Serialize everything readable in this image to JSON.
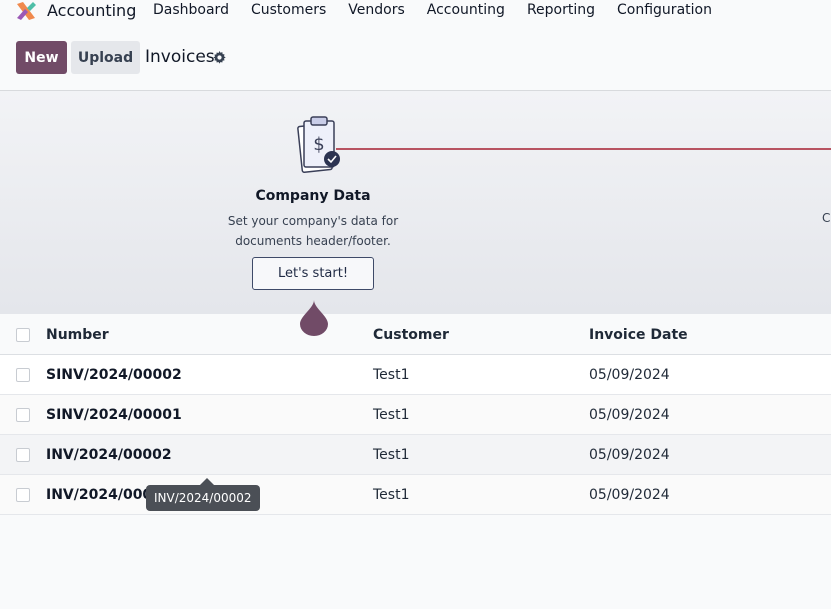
{
  "app": {
    "name": "Accounting",
    "logo_icon": "odoo-accounting-logo-icon"
  },
  "menu": [
    "Dashboard",
    "Customers",
    "Vendors",
    "Accounting",
    "Reporting",
    "Configuration"
  ],
  "control": {
    "new_label": "New",
    "upload_label": "Upload",
    "title": "Invoices",
    "settings_icon": "gear-icon"
  },
  "onboarding": {
    "step_title": "Company Data",
    "step_desc_line1": "Set your company's data for",
    "step_desc_line2": "documents header/footer.",
    "step_button": "Let's start!",
    "next_step_partial": "C",
    "accent": "#714b67",
    "line_color": "#b85361"
  },
  "table": {
    "columns": {
      "number": "Number",
      "customer": "Customer",
      "date": "Invoice Date"
    },
    "rows": [
      {
        "number": "SINV/2024/00002",
        "customer": "Test1",
        "date": "05/09/2024"
      },
      {
        "number": "SINV/2024/00001",
        "customer": "Test1",
        "date": "05/09/2024"
      },
      {
        "number": "INV/2024/00002",
        "customer": "Test1",
        "date": "05/09/2024"
      },
      {
        "number": "INV/2024/00001",
        "customer": "Test1",
        "date": "05/09/2024"
      }
    ]
  },
  "tooltip": {
    "text": "INV/2024/00002"
  }
}
